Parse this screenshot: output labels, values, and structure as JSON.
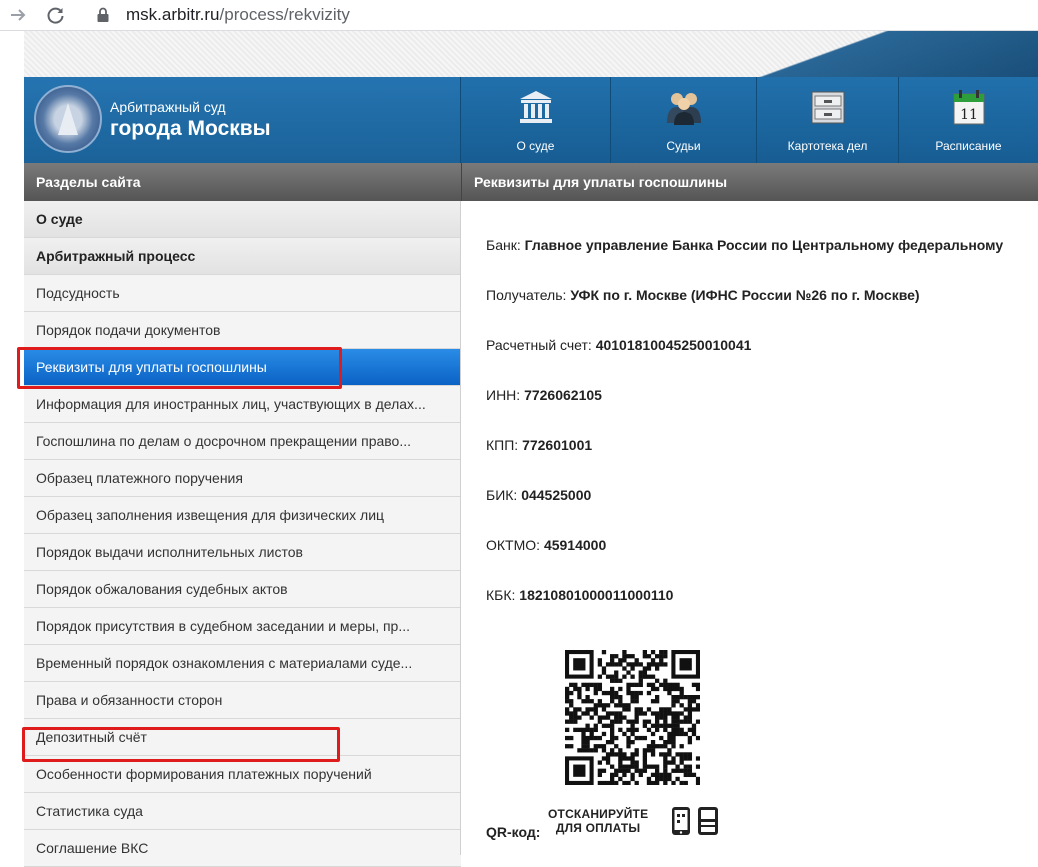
{
  "browser": {
    "url_host": "msk.arbitr.ru",
    "url_path": "/process/rekvizity"
  },
  "header": {
    "court_line1": "Арбитражный суд",
    "court_line2": "города Москвы",
    "nav": [
      {
        "label": "О суде",
        "icon": "courthouse-icon"
      },
      {
        "label": "Судьи",
        "icon": "judges-icon"
      },
      {
        "label": "Картотека дел",
        "icon": "file-cabinet-icon"
      },
      {
        "label": "Расписание",
        "icon": "calendar-icon",
        "day": "11"
      }
    ]
  },
  "sidebar": {
    "title": "Разделы сайта",
    "items": [
      {
        "label": "О суде"
      },
      {
        "label": "Арбитражный процесс"
      },
      {
        "label": "Подсудность"
      },
      {
        "label": "Порядок подачи документов"
      },
      {
        "label": "Реквизиты для уплаты госпошлины"
      },
      {
        "label": "Информация для иностранных лиц, участвующих в делах..."
      },
      {
        "label": "Госпошлина по делам о досрочном прекращении право..."
      },
      {
        "label": "Образец платежного поручения"
      },
      {
        "label": "Образец заполнения извещения для физических лиц"
      },
      {
        "label": "Порядок выдачи исполнительных листов"
      },
      {
        "label": "Порядок обжалования судебных актов"
      },
      {
        "label": "Порядок присутствия в судебном заседании и меры, пр..."
      },
      {
        "label": "Временный порядок ознакомления с материалами суде..."
      },
      {
        "label": "Права и обязанности сторон"
      },
      {
        "label": "Депозитный счёт"
      },
      {
        "label": "Особенности формирования платежных поручений"
      },
      {
        "label": "Статистика суда"
      },
      {
        "label": "Соглашение ВКС"
      }
    ]
  },
  "content": {
    "title": "Реквизиты для уплаты госпошлины",
    "bank_label": "Банк:",
    "bank_value": "Главное управление Банка России по Центральному федеральному",
    "recipient_label": "Получатель:",
    "recipient_value": "УФК по г. Москве (ИФНС России №26 по г. Москве)",
    "account_label": "Расчетный счет:",
    "account_value": "40101810045250010041",
    "inn_label": "ИНН:",
    "inn_value": "7726062105",
    "kpp_label": "КПП:",
    "kpp_value": "772601001",
    "bik_label": "БИК:",
    "bik_value": "044525000",
    "oktmo_label": "ОКТМО:",
    "oktmo_value": "45914000",
    "kbk_label": "КБК:",
    "kbk_value": "18210801000011000110",
    "qr_label": "QR-код:",
    "scan_line1": "ОТСКАНИРУЙТЕ",
    "scan_line2": "ДЛЯ ОПЛАТЫ"
  },
  "colors": {
    "header_blue": "#1f6aa3",
    "active_item": "#0b62c5",
    "highlight_red": "#e01b1b"
  }
}
